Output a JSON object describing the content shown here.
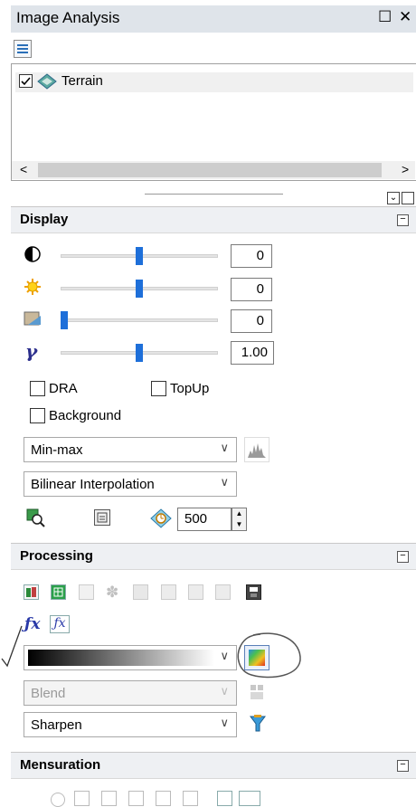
{
  "window": {
    "title": "Image Analysis",
    "close_glyph": "✕",
    "float_glyph": "☐"
  },
  "layers": [
    {
      "name": "Terrain",
      "checked": true
    }
  ],
  "scroll": {
    "left": "<",
    "right": ">"
  },
  "display": {
    "title": "Display",
    "sliders": [
      {
        "icon": "contrast-icon",
        "value": "0",
        "level": 0.5
      },
      {
        "icon": "brightness-icon",
        "value": "0",
        "level": 0.5
      },
      {
        "icon": "transparency-icon",
        "value": "0",
        "level": 0.0
      },
      {
        "icon": "gamma-icon",
        "value": "1.00",
        "level": 0.5
      }
    ],
    "dra_label": "DRA",
    "topup_label": "TopUp",
    "background_label": "Background",
    "stretch": "Min-max",
    "resampling": "Bilinear Interpolation",
    "refresh_value": "500"
  },
  "processing": {
    "title": "Processing",
    "gradient_combo": "",
    "blend": "Blend",
    "sharpen": "Sharpen"
  },
  "mensuration": {
    "title": "Mensuration"
  },
  "colors": {
    "accent": "#1e6fd9",
    "section_bg": "#eef0f3",
    "title_bg": "#dfe4ea"
  }
}
